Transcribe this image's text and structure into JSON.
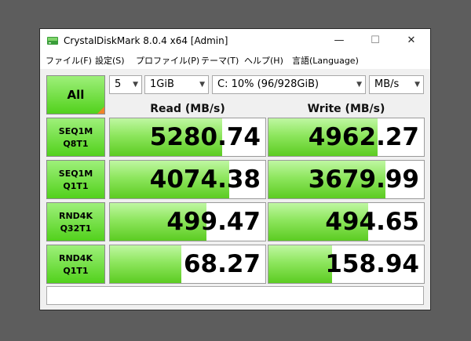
{
  "window": {
    "title": "CrystalDiskMark 8.0.4 x64 [Admin]",
    "controls": {
      "minimize": "—",
      "maximize": "☐",
      "close": "✕"
    }
  },
  "menu": [
    "ファイル(F)",
    "設定(S)",
    "プロファイル(P)",
    "テーマ(T)",
    "ヘルプ(H)",
    "言語(Language)"
  ],
  "toolbar": {
    "all_label": "All",
    "count": "5",
    "size": "1GiB",
    "drive": "C: 10% (96/928GiB)",
    "unit": "MB/s"
  },
  "headers": {
    "read": "Read (MB/s)",
    "write": "Write (MB/s)"
  },
  "tests": [
    {
      "line1": "SEQ1M",
      "line2": "Q8T1",
      "read": "5280.74",
      "write": "4962.27",
      "read_fill": 0.72,
      "write_fill": 0.7
    },
    {
      "line1": "SEQ1M",
      "line2": "Q1T1",
      "read": "4074.38",
      "write": "3679.99",
      "read_fill": 0.77,
      "write_fill": 0.75
    },
    {
      "line1": "RND4K",
      "line2": "Q32T1",
      "read": "499.47",
      "write": "494.65",
      "read_fill": 0.62,
      "write_fill": 0.64
    },
    {
      "line1": "RND4K",
      "line2": "Q1T1",
      "read": "68.27",
      "write": "158.94",
      "read_fill": 0.46,
      "write_fill": 0.41
    }
  ],
  "comment": "",
  "colors": {
    "bar_green": "#5ccc22",
    "corner_orange": "#f0842a"
  }
}
